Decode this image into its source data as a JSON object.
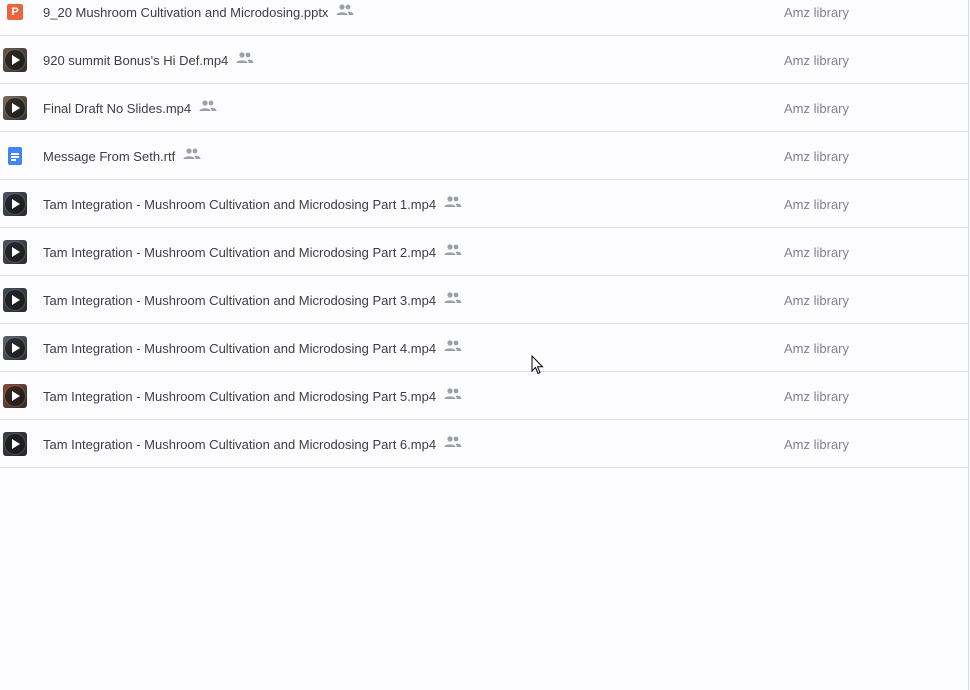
{
  "files": [
    {
      "name": "9_20 Mushroom Cultivation and Microdosing.pptx",
      "type": "pptx",
      "icon": "powerpoint-icon",
      "owner": "Amz library",
      "thumb_color": "#e8663d"
    },
    {
      "name": "920 summit Bonus's Hi Def.mp4",
      "type": "video",
      "icon": "video-play-icon",
      "owner": "Amz library",
      "thumb_color": "#6b5a4e"
    },
    {
      "name": "Final Draft No Slides.mp4",
      "type": "video",
      "icon": "video-play-icon",
      "owner": "Amz library",
      "thumb_color": "#7a6a5c"
    },
    {
      "name": "Message From Seth.rtf",
      "type": "doc",
      "icon": "document-icon",
      "owner": "Amz library",
      "thumb_color": "#4285f4"
    },
    {
      "name": "Tam Integration - Mushroom Cultivation and Microdosing Part 1.mp4",
      "type": "video",
      "icon": "video-play-icon",
      "owner": "Amz library",
      "thumb_color": "#4a5260"
    },
    {
      "name": "Tam Integration - Mushroom Cultivation and Microdosing Part 2.mp4",
      "type": "video",
      "icon": "video-play-icon",
      "owner": "Amz library",
      "thumb_color": "#4d5561"
    },
    {
      "name": "Tam Integration - Mushroom Cultivation and Microdosing Part 3.mp4",
      "type": "video",
      "icon": "video-play-icon",
      "owner": "Amz library",
      "thumb_color": "#3f4a57"
    },
    {
      "name": "Tam Integration - Mushroom Cultivation and Microdosing Part 4.mp4",
      "type": "video",
      "icon": "video-play-icon",
      "owner": "Amz library",
      "thumb_color": "#5b6470"
    },
    {
      "name": "Tam Integration - Mushroom Cultivation and Microdosing Part 5.mp4",
      "type": "video",
      "icon": "video-play-icon",
      "owner": "Amz library",
      "thumb_color": "#8a4a3a"
    },
    {
      "name": "Tam Integration - Mushroom Cultivation and Microdosing Part 6.mp4",
      "type": "video",
      "icon": "video-play-icon",
      "owner": "Amz library",
      "thumb_color": "#3a3f4a"
    }
  ],
  "shared_icon": "people-shared-icon",
  "colors": {
    "divider": "#dadce0",
    "name_text": "#3c4043",
    "owner_text": "#80868b",
    "shared_icon": "#9aa0a6"
  }
}
